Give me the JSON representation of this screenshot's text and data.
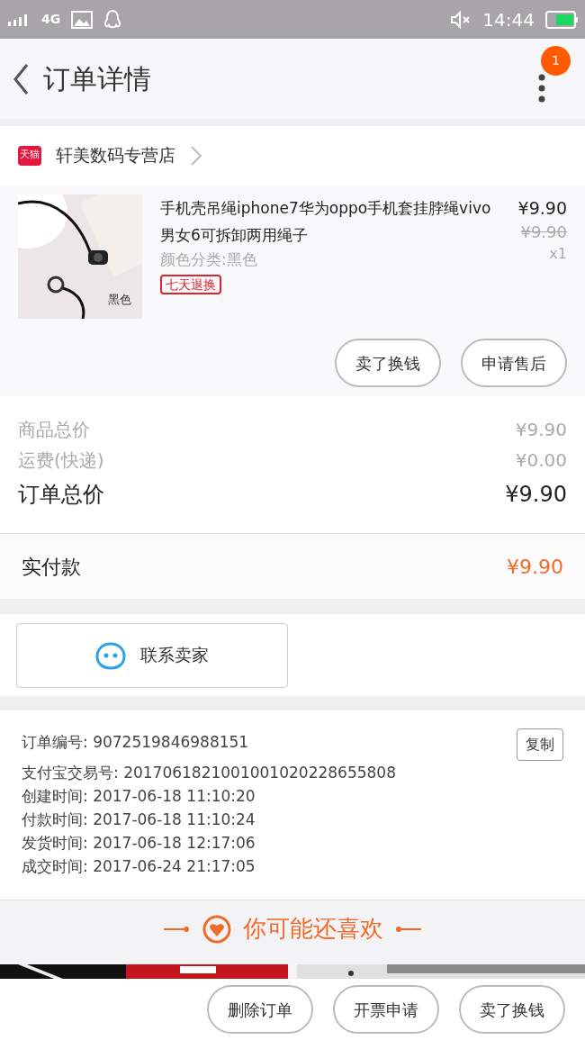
{
  "status_bar": {
    "network": "4G",
    "time": "14:44"
  },
  "header": {
    "title": "订单详情",
    "badge": "1"
  },
  "shop": {
    "name": "天猫 轩美数码专营店"
  },
  "product": {
    "image_label": "黑色",
    "title": "手机壳吊绳iphone7华为oppo手机套挂脖绳vivo男女6可拆卸两用绳子",
    "variant": "颜色分类:黑色",
    "tag": "七天退换",
    "price": "¥9.90",
    "original_price": "¥9.90",
    "quantity": "x1",
    "buttons": [
      "卖了换钱",
      "申请售后"
    ]
  },
  "summary": [
    {
      "label": "商品总价",
      "value": "¥9.90",
      "kind": "minor"
    },
    {
      "label": "运费(快递)",
      "value": "¥0.00",
      "kind": "minor"
    },
    {
      "label": "订单总价",
      "value": "¥9.90",
      "kind": "major"
    }
  ],
  "paid": {
    "label": "实付款",
    "value": "¥9.90"
  },
  "contact_button": "联系卖家",
  "order_info": {
    "copy_button": "复制",
    "lines": [
      "订单编号: 9072519846988151",
      "支付宝交易号: 2017061821001001020228655808",
      "创建时间: 2017-06-18 11:10:20",
      "付款时间: 2017-06-18 11:10:24",
      "发货时间: 2017-06-18 12:17:06",
      "成交时间: 2017-06-24 21:17:05"
    ]
  },
  "recommend": {
    "title": "你可能还喜欢"
  },
  "bottom_buttons": [
    "删除订单",
    "开票申请",
    "卖了换钱"
  ]
}
